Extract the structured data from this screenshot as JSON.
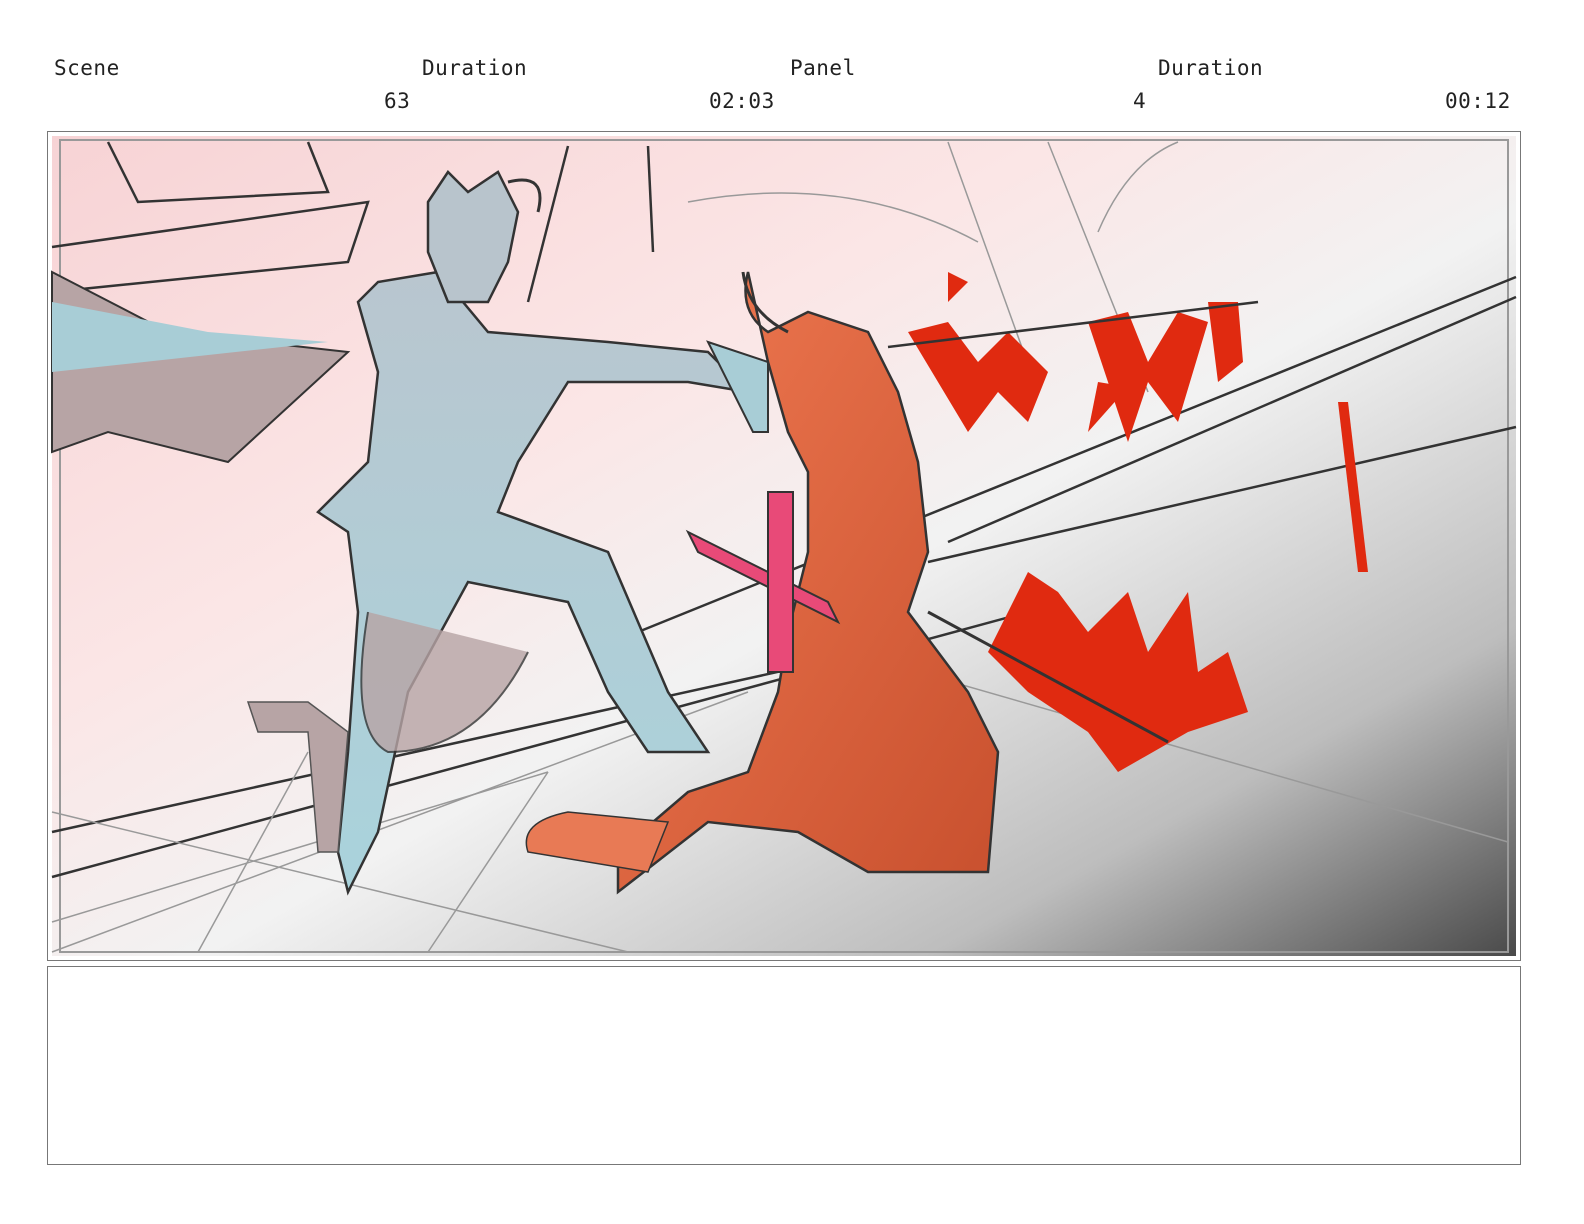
{
  "header": {
    "scene_label": "Scene",
    "scene_duration_label": "Duration",
    "panel_label": "Panel",
    "panel_duration_label": "Duration",
    "scene_value": "63",
    "scene_duration_value": "02:03",
    "panel_value": "4",
    "panel_duration_value": "00:12"
  },
  "colors": {
    "left_figure": "#a9c9d2",
    "right_figure": "#e8704a",
    "blood": "#e02a10",
    "sword": "#e84a78",
    "background_tint": "#f6c9cc",
    "shadow_gradient_end": "#4a4a4a"
  },
  "panel": {
    "image_description_icon": "storyboard-sketch",
    "notes_text": ""
  }
}
